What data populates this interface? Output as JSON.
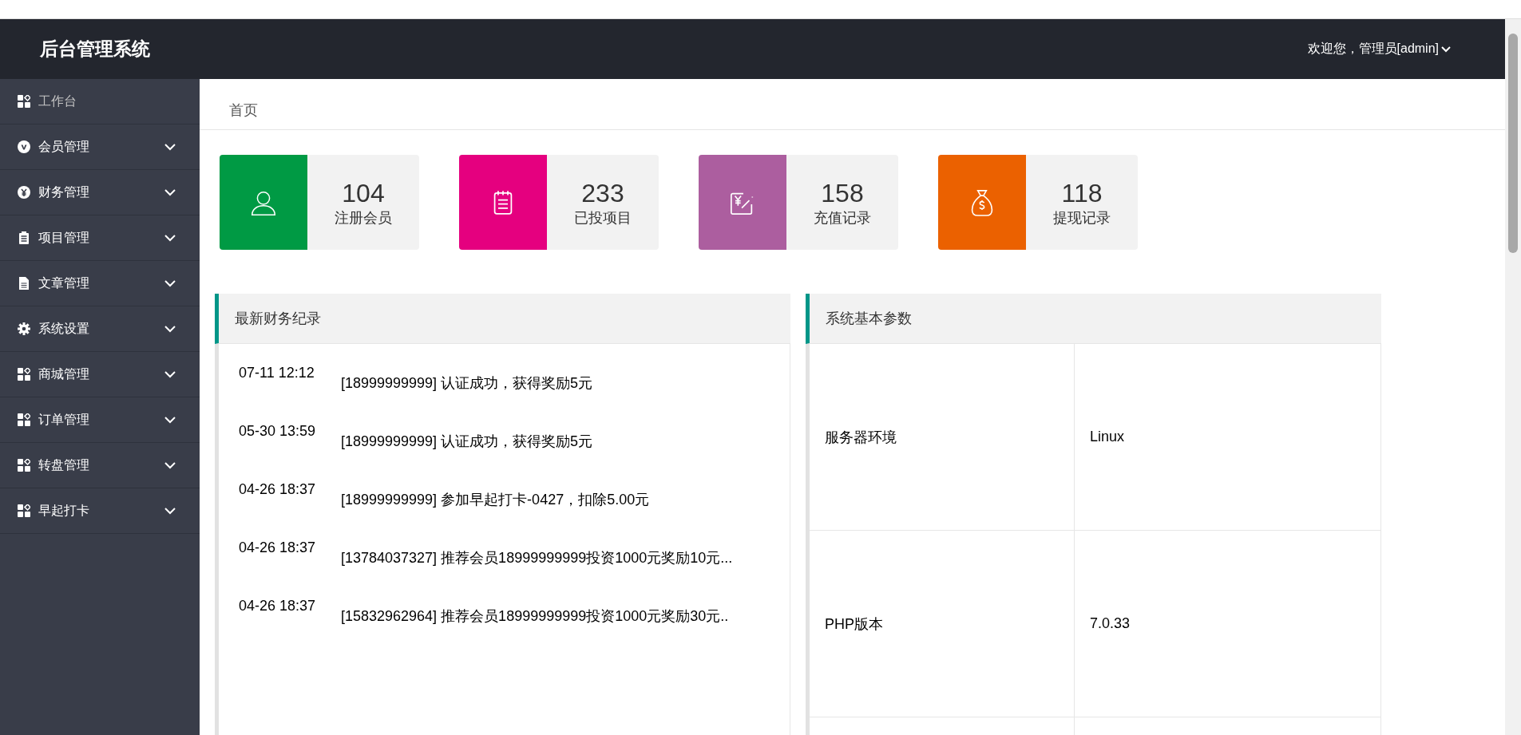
{
  "header": {
    "title": "后台管理系统",
    "user": "欢迎您，管理员[admin]"
  },
  "sidebar": {
    "items": [
      {
        "label": "工作台",
        "kind": "link"
      },
      {
        "label": "会员管理",
        "kind": "group",
        "expanded": false
      },
      {
        "label": "财务管理",
        "kind": "group",
        "expanded": false
      },
      {
        "label": "项目管理",
        "kind": "group",
        "expanded": false
      },
      {
        "label": "文章管理",
        "kind": "group",
        "expanded": false
      },
      {
        "label": "系统设置",
        "kind": "group",
        "expanded": false
      },
      {
        "label": "商城管理",
        "kind": "group",
        "expanded": false
      },
      {
        "label": "订单管理",
        "kind": "group",
        "expanded": false
      },
      {
        "label": "转盘管理",
        "kind": "group",
        "expanded": false
      },
      {
        "label": "早起打卡",
        "kind": "group",
        "expanded": false
      }
    ]
  },
  "breadcrumb": "首页",
  "stats": [
    {
      "value": "104",
      "label": "注册会员",
      "color": "#009a44"
    },
    {
      "value": "233",
      "label": "已投项目",
      "color": "#e5007f"
    },
    {
      "value": "158",
      "label": "充值记录",
      "color": "#ac5e9f"
    },
    {
      "value": "118",
      "label": "提现记录",
      "color": "#eb6100"
    }
  ],
  "finance_panel": {
    "title": "最新财务纪录",
    "records": [
      {
        "time": "07-11 12:12",
        "text": "[18999999999] 认证成功，获得奖励5元"
      },
      {
        "time": "05-30 13:59",
        "text": "[18999999999] 认证成功，获得奖励5元"
      },
      {
        "time": "04-26 18:37",
        "text": "[18999999999] 参加早起打卡-0427，扣除5.00元"
      },
      {
        "time": "04-26 18:37",
        "text": "[13784037327] 推荐会员18999999999投资1000元奖励10元..."
      },
      {
        "time": "04-26 18:37",
        "text": "[15832962964] 推荐会员18999999999投资1000元奖励30元.."
      }
    ]
  },
  "system_panel": {
    "title": "系统基本参数",
    "rows": [
      {
        "name": "服务器环境",
        "value": "Linux"
      },
      {
        "name": "PHP版本",
        "value": "7.0.33"
      }
    ]
  }
}
